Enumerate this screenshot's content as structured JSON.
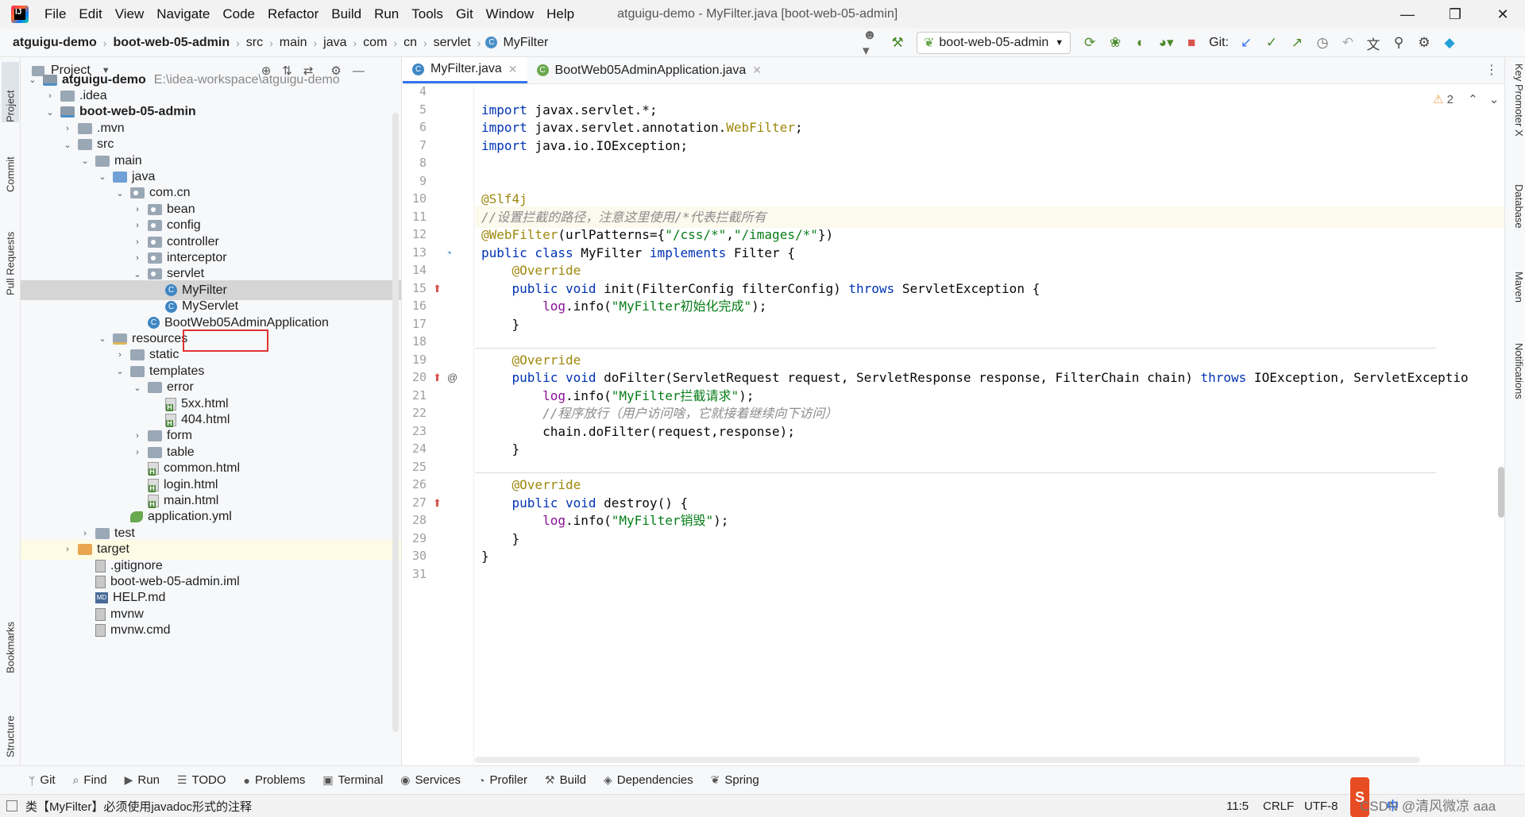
{
  "window": {
    "title": "atguigu-demo - MyFilter.java [boot-web-05-admin]",
    "menu": [
      "File",
      "Edit",
      "View",
      "Navigate",
      "Code",
      "Refactor",
      "Build",
      "Run",
      "Tools",
      "Git",
      "Window",
      "Help"
    ],
    "controls": {
      "minimize": "—",
      "maximize": "❐",
      "close": "✕"
    }
  },
  "breadcrumbs": [
    {
      "label": "atguigu-demo",
      "bold": true
    },
    {
      "label": "boot-web-05-admin",
      "bold": true
    },
    {
      "label": "src"
    },
    {
      "label": "main"
    },
    {
      "label": "java"
    },
    {
      "label": "com"
    },
    {
      "label": "cn"
    },
    {
      "label": "servlet"
    },
    {
      "label": "MyFilter",
      "icon": "class-icon"
    }
  ],
  "toolbar": {
    "run_config": "boot-web-05-admin",
    "git_label": "Git:"
  },
  "project_panel": {
    "title": "Project",
    "tree": [
      {
        "label": "atguigu-demo",
        "path": "E:\\idea-workspace\\atguigu-demo",
        "depth": 0,
        "arrow": "down",
        "icon": "module",
        "bold": true
      },
      {
        "label": ".idea",
        "depth": 1,
        "arrow": "right",
        "icon": "folder"
      },
      {
        "label": "boot-web-05-admin",
        "depth": 1,
        "arrow": "down",
        "icon": "module",
        "bold": true
      },
      {
        "label": ".mvn",
        "depth": 2,
        "arrow": "right",
        "icon": "folder"
      },
      {
        "label": "src",
        "depth": 2,
        "arrow": "down",
        "icon": "folder"
      },
      {
        "label": "main",
        "depth": 3,
        "arrow": "down",
        "icon": "folder"
      },
      {
        "label": "java",
        "depth": 4,
        "arrow": "down",
        "icon": "src"
      },
      {
        "label": "com.cn",
        "depth": 5,
        "arrow": "down",
        "icon": "pkg"
      },
      {
        "label": "bean",
        "depth": 6,
        "arrow": "right",
        "icon": "pkg"
      },
      {
        "label": "config",
        "depth": 6,
        "arrow": "right",
        "icon": "pkg"
      },
      {
        "label": "controller",
        "depth": 6,
        "arrow": "right",
        "icon": "pkg"
      },
      {
        "label": "interceptor",
        "depth": 6,
        "arrow": "right",
        "icon": "pkg"
      },
      {
        "label": "servlet",
        "depth": 6,
        "arrow": "down",
        "icon": "pkg"
      },
      {
        "label": "MyFilter",
        "depth": 7,
        "arrow": "none",
        "icon": "cls",
        "selected": true
      },
      {
        "label": "MyServlet",
        "depth": 7,
        "arrow": "none",
        "icon": "cls"
      },
      {
        "label": "BootWeb05AdminApplication",
        "depth": 6,
        "arrow": "none",
        "icon": "cls"
      },
      {
        "label": "resources",
        "depth": 4,
        "arrow": "down",
        "icon": "res"
      },
      {
        "label": "static",
        "depth": 5,
        "arrow": "right",
        "icon": "folder"
      },
      {
        "label": "templates",
        "depth": 5,
        "arrow": "down",
        "icon": "folder"
      },
      {
        "label": "error",
        "depth": 6,
        "arrow": "down",
        "icon": "folder"
      },
      {
        "label": "5xx.html",
        "depth": 7,
        "arrow": "none",
        "icon": "html"
      },
      {
        "label": "404.html",
        "depth": 7,
        "arrow": "none",
        "icon": "html"
      },
      {
        "label": "form",
        "depth": 6,
        "arrow": "right",
        "icon": "folder"
      },
      {
        "label": "table",
        "depth": 6,
        "arrow": "right",
        "icon": "folder"
      },
      {
        "label": "common.html",
        "depth": 6,
        "arrow": "none",
        "icon": "html"
      },
      {
        "label": "login.html",
        "depth": 6,
        "arrow": "none",
        "icon": "html"
      },
      {
        "label": "main.html",
        "depth": 6,
        "arrow": "none",
        "icon": "html"
      },
      {
        "label": "application.yml",
        "depth": 5,
        "arrow": "none",
        "icon": "yml"
      },
      {
        "label": "test",
        "depth": 3,
        "arrow": "right",
        "icon": "folder"
      },
      {
        "label": "target",
        "depth": 2,
        "arrow": "right",
        "icon": "excluded",
        "highlight": true
      },
      {
        "label": ".gitignore",
        "depth": 3,
        "arrow": "none",
        "icon": "file"
      },
      {
        "label": "boot-web-05-admin.iml",
        "depth": 3,
        "arrow": "none",
        "icon": "file"
      },
      {
        "label": "HELP.md",
        "depth": 3,
        "arrow": "none",
        "icon": "md"
      },
      {
        "label": "mvnw",
        "depth": 3,
        "arrow": "none",
        "icon": "file"
      },
      {
        "label": "mvnw.cmd",
        "depth": 3,
        "arrow": "none",
        "icon": "file"
      }
    ]
  },
  "left_tabs": [
    "Project",
    "Commit",
    "Pull Requests",
    "Bookmarks",
    "Structure"
  ],
  "right_tabs": [
    "Key Promoter X",
    "Database",
    "Maven",
    "Notifications"
  ],
  "editor": {
    "tabs": [
      {
        "label": "MyFilter.java",
        "active": true,
        "icon": "class"
      },
      {
        "label": "BootWeb05AdminApplication.java",
        "active": false,
        "icon": "spring"
      }
    ],
    "warnings": "2",
    "current_line": 11,
    "lines": [
      {
        "n": "4",
        "html": ""
      },
      {
        "n": "5",
        "html": "<span class=\"kw\">import</span> javax.servlet.*;"
      },
      {
        "n": "6",
        "html": "<span class=\"kw\">import</span> javax.servlet.annotation.<span class=\"ann\">WebFilter</span>;"
      },
      {
        "n": "7",
        "html": "<span class=\"kw\">import</span> java.io.IOException;"
      },
      {
        "n": "8",
        "html": ""
      },
      {
        "n": "9",
        "html": ""
      },
      {
        "n": "10",
        "html": "<span class=\"ann\">@Slf4j</span>"
      },
      {
        "n": "11",
        "html": "<span class=\"cmt\">//设置拦截的路径，注意这里使用/*代表拦截所有</span>"
      },
      {
        "n": "12",
        "html": "<span class=\"ann\">@WebFilter</span>(urlPatterns={<span class=\"str\">\"/css/*\"</span>,<span class=\"str\">\"/images/*\"</span>})"
      },
      {
        "n": "13",
        "html": "<span class=\"kw\">public class</span> MyFilter <span class=\"kw\">implements</span> Filter {"
      },
      {
        "n": "14",
        "html": "    <span class=\"ann\">@Override</span>"
      },
      {
        "n": "15",
        "html": "    <span class=\"kw\">public void</span> init(FilterConfig filterConfig) <span class=\"kw\">throws</span> ServletException {"
      },
      {
        "n": "16",
        "html": "        <span class=\"fld\">log</span>.info(<span class=\"str\">\"MyFilter初始化完成\"</span>);"
      },
      {
        "n": "17",
        "html": "    }"
      },
      {
        "n": "18",
        "html": ""
      },
      {
        "n": "19",
        "html": "    <span class=\"ann\">@Override</span>"
      },
      {
        "n": "20",
        "html": "    <span class=\"kw\">public void</span> doFilter(ServletRequest request, ServletResponse response, FilterChain chain) <span class=\"kw\">throws</span> IOException, ServletExceptio"
      },
      {
        "n": "21",
        "html": "        <span class=\"fld\">log</span>.info(<span class=\"str\">\"MyFilter拦截请求\"</span>);"
      },
      {
        "n": "22",
        "html": "        <span class=\"cmt\">//程序放行（用户访问啥，它就接着继续向下访问）</span>"
      },
      {
        "n": "23",
        "html": "        chain.doFilter(request,response);"
      },
      {
        "n": "24",
        "html": "    }"
      },
      {
        "n": "25",
        "html": ""
      },
      {
        "n": "26",
        "html": "    <span class=\"ann\">@Override</span>"
      },
      {
        "n": "27",
        "html": "    <span class=\"kw\">public void</span> destroy() {"
      },
      {
        "n": "28",
        "html": "        <span class=\"fld\">log</span>.info(<span class=\"str\">\"MyFilter销毁\"</span>);"
      },
      {
        "n": "29",
        "html": "    }"
      },
      {
        "n": "30",
        "html": "}"
      },
      {
        "n": "31",
        "html": ""
      }
    ]
  },
  "bottom_tools": [
    {
      "label": "Git",
      "icon": "git-icon",
      "glyph": "ᛘ"
    },
    {
      "label": "Find",
      "icon": "search-icon",
      "glyph": "⌕"
    },
    {
      "label": "Run",
      "icon": "run-icon",
      "glyph": "▶"
    },
    {
      "label": "TODO",
      "icon": "todo-icon",
      "glyph": "☰"
    },
    {
      "label": "Problems",
      "icon": "problems-icon",
      "glyph": "●"
    },
    {
      "label": "Terminal",
      "icon": "terminal-icon",
      "glyph": "▣"
    },
    {
      "label": "Services",
      "icon": "services-icon",
      "glyph": "◉"
    },
    {
      "label": "Profiler",
      "icon": "profiler-icon",
      "glyph": "◔"
    },
    {
      "label": "Build",
      "icon": "build-icon",
      "glyph": "⚒"
    },
    {
      "label": "Dependencies",
      "icon": "dependencies-icon",
      "glyph": "◈"
    },
    {
      "label": "Spring",
      "icon": "spring-icon",
      "glyph": "❦"
    }
  ],
  "status": {
    "message": "类【MyFilter】必须使用javadoc形式的注释",
    "position": "11:5",
    "line_ending": "CRLF",
    "encoding": "UTF-8",
    "watermark": "CSDN @清风微凉 aaa",
    "ime": "中"
  },
  "colors": {
    "accent": "#3574f0",
    "selection_box": "#e03131",
    "keyword": "#0033b3",
    "annotation": "#9e880d",
    "string": "#067d17"
  }
}
